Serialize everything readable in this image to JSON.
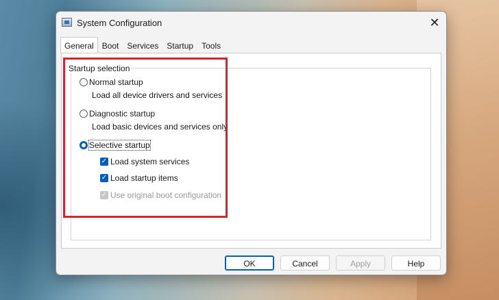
{
  "window": {
    "title": "System Configuration",
    "close_glyph": "✕"
  },
  "tabs": [
    {
      "label": "General",
      "active": true
    },
    {
      "label": "Boot",
      "active": false
    },
    {
      "label": "Services",
      "active": false
    },
    {
      "label": "Startup",
      "active": false
    },
    {
      "label": "Tools",
      "active": false
    }
  ],
  "startup_selection": {
    "label": "Startup selection",
    "normal": {
      "label": "Normal startup",
      "description": "Load all device drivers and services",
      "selected": false
    },
    "diagnostic": {
      "label": "Diagnostic startup",
      "description": "Load basic devices and services only",
      "selected": false
    },
    "selective": {
      "label": "Selective startup",
      "selected": true,
      "options": [
        {
          "label": "Load system services",
          "checked": true,
          "enabled": true
        },
        {
          "label": "Load startup items",
          "checked": true,
          "enabled": true
        },
        {
          "label": "Use original boot configuration",
          "checked": true,
          "enabled": false
        }
      ]
    }
  },
  "buttons": {
    "ok": "OK",
    "cancel": "Cancel",
    "apply": "Apply",
    "help": "Help"
  },
  "colors": {
    "accent": "#005fb8",
    "highlight_box": "#d6232e"
  },
  "icons": {
    "app": "system-configuration-icon",
    "check": "✓"
  }
}
